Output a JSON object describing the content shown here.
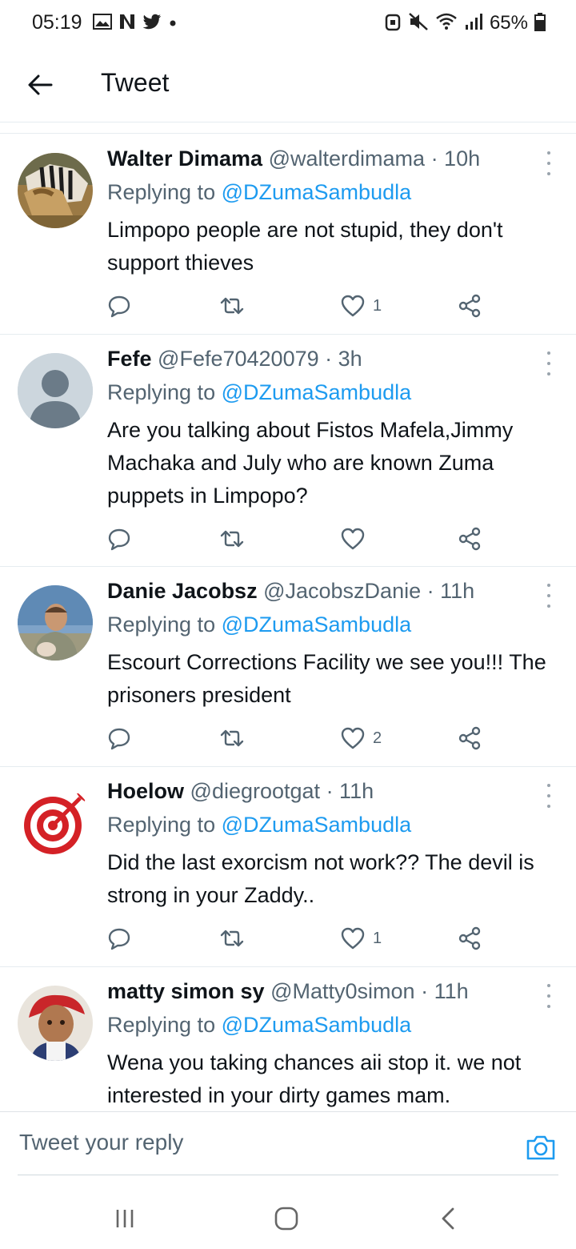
{
  "status_bar": {
    "time": "05:19",
    "battery": "65%",
    "left_icons": [
      "gallery-icon",
      "netflix-icon",
      "twitter-icon",
      "dot-icon"
    ],
    "right_icons": [
      "alarm-icon",
      "mute-icon",
      "wifi-icon",
      "signal-icon",
      "battery-icon"
    ]
  },
  "header": {
    "title": "Tweet"
  },
  "tweets": [
    {
      "name": "Walter Dimama",
      "handle": "@walterdimama",
      "time": "· 10h",
      "replying_prefix": "Replying to",
      "replying_to": "@DZumaSambudla",
      "text": "Limpopo people are not stupid,  they don't support thieves",
      "likes": "1"
    },
    {
      "name": "Fefe",
      "handle": "@Fefe70420079",
      "time": "· 3h",
      "replying_prefix": "Replying to",
      "replying_to": "@DZumaSambudla",
      "text": "Are you talking about Fistos Mafela,Jimmy Machaka and July who are known Zuma puppets in Limpopo?",
      "likes": ""
    },
    {
      "name": "Danie Jacobsz",
      "handle": "@JacobszDanie",
      "time": "· 11h",
      "replying_prefix": "Replying to",
      "replying_to": "@DZumaSambudla",
      "text": "Escourt Corrections Facility we see you!!! The prisoners president",
      "likes": "2"
    },
    {
      "name": "Hoelow",
      "handle": "@diegrootgat",
      "time": "· 11h",
      "replying_prefix": "Replying to",
      "replying_to": "@DZumaSambudla",
      "text": "Did the last exorcism not work?? The devil is strong in your Zaddy..",
      "likes": "1"
    },
    {
      "name": "matty simon sy",
      "handle": "@Matty0simon",
      "time": "· 11h",
      "replying_prefix": "Replying to",
      "replying_to": "@DZumaSambudla",
      "text": "Wena you taking chances aii stop it. we not interested in your dirty games mam.",
      "likes": ""
    }
  ],
  "reply_bar": {
    "placeholder": "Tweet your reply"
  },
  "nav_bar": {
    "buttons": [
      "recent-apps-icon",
      "home-icon",
      "back-icon"
    ]
  },
  "colors": {
    "accent": "#1d9bf0",
    "secondary_text": "#536471",
    "primary_text": "#0f1419"
  }
}
